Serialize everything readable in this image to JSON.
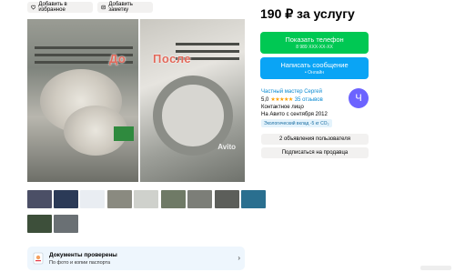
{
  "toolbar": {
    "favorite_label": "Добавить в избранное",
    "note_label": "Добавить заметку"
  },
  "gallery": {
    "before_label": "До",
    "after_label": "После",
    "watermark": "Avito",
    "thumbnails": [
      {
        "color": "#4b4f66"
      },
      {
        "color": "#2b3a57"
      },
      {
        "color": "#e9edf2"
      },
      {
        "color": "#8a8a80"
      },
      {
        "color": "#cfd1cc"
      },
      {
        "color": "#6f7a66"
      },
      {
        "color": "#7c7e78"
      },
      {
        "color": "#5c5e5a"
      },
      {
        "color": "#2a6f8f"
      },
      {
        "color": "#3d4f3a"
      },
      {
        "color": "#6a7074"
      }
    ]
  },
  "verification": {
    "title": "Документы проверены",
    "subtitle": "По фото и копии паспорта"
  },
  "listing": {
    "price": "190 ₽ за услугу"
  },
  "actions": {
    "phone_label": "Показать телефон",
    "phone_sub": "8 989 XXX-XX-XX",
    "message_label": "Написать сообщение",
    "message_sub": "• Онлайн"
  },
  "seller": {
    "name": "Частный мастер Сергей",
    "rating": "5,0",
    "stars": "★★★★★",
    "reviews": "35 отзывов",
    "contact_type": "Контактное лицо",
    "since": "На Авито с сентября 2012",
    "eco_badge": "Экологический вклад -5 кг CO₂",
    "avatar_letter": "Ч",
    "avatar_color": "#6c63ff",
    "ads_button": "2 объявления пользователя",
    "subscribe_button": "Подписаться на продавца"
  }
}
